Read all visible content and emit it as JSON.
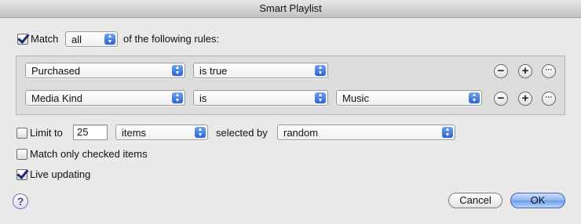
{
  "window": {
    "title": "Smart Playlist"
  },
  "match": {
    "checked": true,
    "label": "Match",
    "mode": "all",
    "suffix": "of the following rules:"
  },
  "rules": [
    {
      "field": "Purchased",
      "operator": "is true",
      "value": ""
    },
    {
      "field": "Media Kind",
      "operator": "is",
      "value": "Music"
    }
  ],
  "rule_buttons": {
    "remove": "−",
    "add": "+",
    "more": "···"
  },
  "limit": {
    "checked": false,
    "label": "Limit to",
    "value": "25",
    "unit": "items",
    "selected_by_label": "selected by",
    "selected_by": "random"
  },
  "match_checked": {
    "checked": false,
    "label": "Match only checked items"
  },
  "live_updating": {
    "checked": true,
    "label": "Live updating"
  },
  "buttons": {
    "help": "?",
    "cancel": "Cancel",
    "ok": "OK"
  },
  "colors": {
    "accent": "#2b63cf",
    "default_button": "#8db4ef"
  }
}
